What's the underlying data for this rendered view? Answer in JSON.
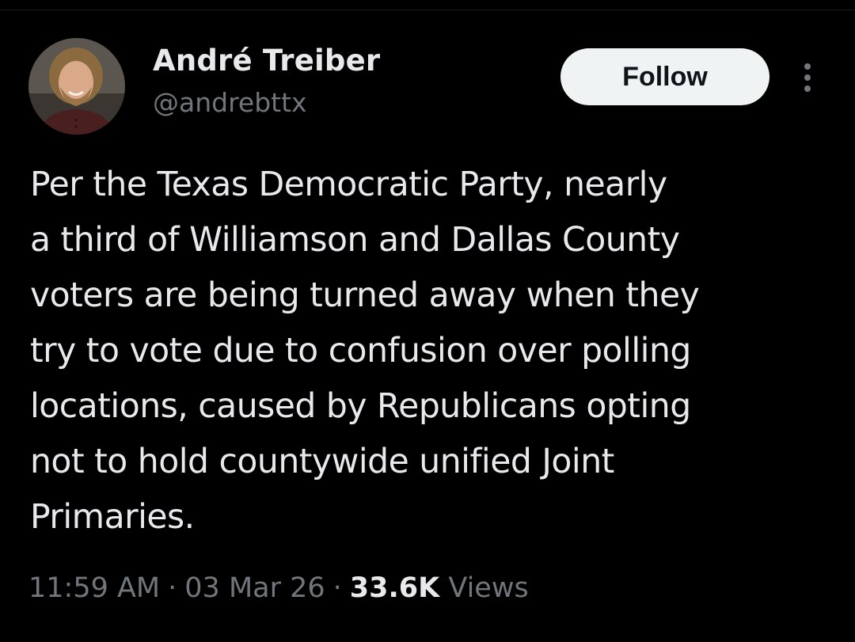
{
  "author": {
    "name": "André Treiber",
    "handle": "@andrebttx",
    "avatar_icon": "profile-photo"
  },
  "follow_button": {
    "label": "Follow"
  },
  "more_menu": {
    "icon": "more-vertical-icon"
  },
  "tweet": {
    "lines": [
      "Per the Texas Democratic Party, nearly",
      "a third of Williamson and Dallas County",
      "voters are being turned away when they",
      "try to vote due to confusion over polling",
      "locations, caused by Republicans opting",
      "not to hold countywide unified Joint",
      "Primaries."
    ]
  },
  "meta": {
    "time": "11:59 AM",
    "separator": "·",
    "date": "03 Mar 26",
    "views_count": "33.6K",
    "views_label": "Views"
  },
  "colors": {
    "background": "#000000",
    "text_primary": "#e7e9ea",
    "text_secondary": "#71767b",
    "button_bg": "#eff3f4",
    "button_text": "#0f1419"
  }
}
